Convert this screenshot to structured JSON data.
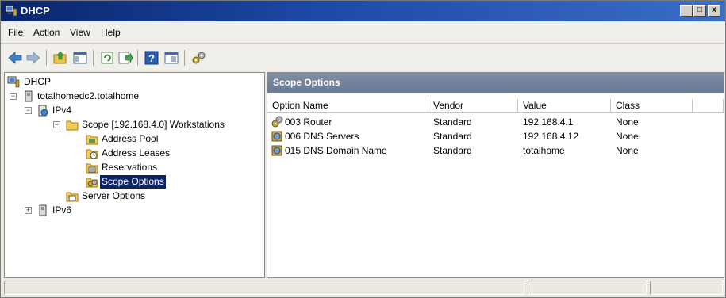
{
  "window": {
    "title": "DHCP",
    "controls": {
      "minimize": "_",
      "maximize": "□",
      "close": "x"
    }
  },
  "menu": {
    "items": [
      {
        "label": "File"
      },
      {
        "label": "Action"
      },
      {
        "label": "View"
      },
      {
        "label": "Help"
      }
    ]
  },
  "toolbar": {
    "buttons": [
      "back-arrow-icon",
      "forward-arrow-icon",
      "up-folder-icon",
      "show-hide-tree-icon",
      "refresh-icon",
      "export-list-icon",
      "help-icon",
      "properties-icon",
      "dhcp-options-icon"
    ]
  },
  "tree": {
    "root": "DHCP",
    "server": "totalhomedc2.totalhome",
    "ipv4": "IPv4",
    "scope": "Scope [192.168.4.0] Workstations",
    "address_pool": "Address Pool",
    "address_leases": "Address Leases",
    "reservations": "Reservations",
    "scope_options": "Scope Options",
    "server_options": "Server Options",
    "ipv6": "IPv6",
    "expand_minus": "−",
    "expand_plus": "+"
  },
  "details": {
    "header": "Scope Options",
    "columns": [
      "Option Name",
      "Vendor",
      "Value",
      "Class"
    ],
    "rows": [
      {
        "name": "003 Router",
        "vendor": "Standard",
        "value": "192.168.4.1",
        "class": "None"
      },
      {
        "name": "006 DNS Servers",
        "vendor": "Standard",
        "value": "192.168.4.12",
        "class": "None"
      },
      {
        "name": "015 DNS Domain Name",
        "vendor": "Standard",
        "value": "totalhome",
        "class": "None"
      }
    ]
  },
  "colors": {
    "titlebar": "#0a246a",
    "selection": "#0a246a",
    "panel_header": "#6b7a93"
  }
}
